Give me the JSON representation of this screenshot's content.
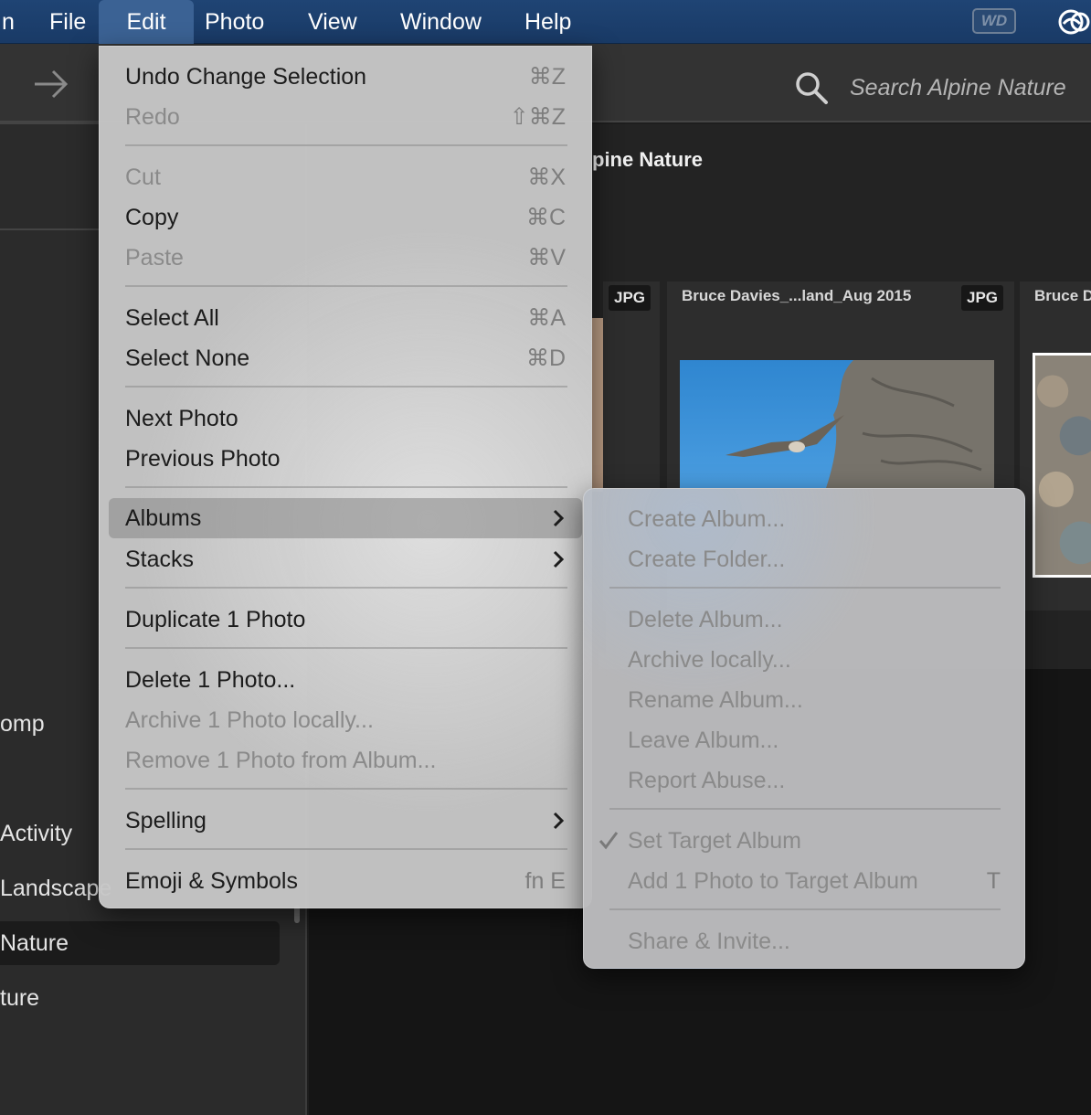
{
  "menubar": {
    "app_fragment": "n",
    "items": [
      "File",
      "Edit",
      "Photo",
      "View",
      "Window",
      "Help"
    ],
    "wd_badge": "WD"
  },
  "toolbar": {
    "search_placeholder": "Search Alpine Nature"
  },
  "sidebar": {
    "items": [
      "omp",
      "Activity",
      "Landscape",
      "Nature",
      "ture"
    ]
  },
  "content": {
    "album_title_fragment": "pine Nature",
    "cards": [
      {
        "name": "",
        "badge": "JPG"
      },
      {
        "name": "Bruce Davies_...land_Aug 2015",
        "badge": "JPG"
      },
      {
        "name": "Bruce D",
        "badge": ""
      }
    ]
  },
  "edit_menu": {
    "items": [
      {
        "label": "Undo Change Selection",
        "shortcut": "⌘Z",
        "enabled": true
      },
      {
        "label": "Redo",
        "shortcut": "⇧⌘Z",
        "enabled": false
      },
      {
        "label": "Cut",
        "shortcut": "⌘X",
        "enabled": false
      },
      {
        "label": "Copy",
        "shortcut": "⌘C",
        "enabled": true
      },
      {
        "label": "Paste",
        "shortcut": "⌘V",
        "enabled": false
      },
      {
        "label": "Select All",
        "shortcut": "⌘A",
        "enabled": true
      },
      {
        "label": "Select None",
        "shortcut": "⌘D",
        "enabled": true
      },
      {
        "label": "Next Photo",
        "shortcut": "",
        "enabled": true
      },
      {
        "label": "Previous Photo",
        "shortcut": "",
        "enabled": true
      },
      {
        "label": "Albums",
        "shortcut": "",
        "enabled": true,
        "submenu": true,
        "highlighted": true
      },
      {
        "label": "Stacks",
        "shortcut": "",
        "enabled": true,
        "submenu": true
      },
      {
        "label": "Duplicate 1 Photo",
        "shortcut": "",
        "enabled": true
      },
      {
        "label": "Delete 1 Photo...",
        "shortcut": "",
        "enabled": true
      },
      {
        "label": "Archive 1 Photo locally...",
        "shortcut": "",
        "enabled": false
      },
      {
        "label": "Remove 1 Photo from Album...",
        "shortcut": "",
        "enabled": false
      },
      {
        "label": "Spelling",
        "shortcut": "",
        "enabled": true,
        "submenu": true
      },
      {
        "label": "Emoji & Symbols",
        "shortcut": "fn E",
        "enabled": true
      }
    ]
  },
  "albums_submenu": {
    "items": [
      {
        "label": "Create Album...",
        "enabled": false
      },
      {
        "label": "Create Folder...",
        "enabled": false
      },
      {
        "label": "Delete Album...",
        "enabled": false
      },
      {
        "label": "Archive locally...",
        "enabled": false
      },
      {
        "label": "Rename Album...",
        "enabled": false
      },
      {
        "label": "Leave Album...",
        "enabled": false
      },
      {
        "label": "Report Abuse...",
        "enabled": false
      },
      {
        "label": "Set Target Album",
        "enabled": false,
        "checked": true
      },
      {
        "label": "Add 1 Photo to Target Album",
        "enabled": false,
        "shortcut": "T"
      },
      {
        "label": "Share & Invite...",
        "enabled": false
      }
    ]
  },
  "colors": {
    "menubar": "#1f4474",
    "menu_bg": "#c6c6c6",
    "sidebar": "#2b2b2b",
    "content": "#151515"
  }
}
